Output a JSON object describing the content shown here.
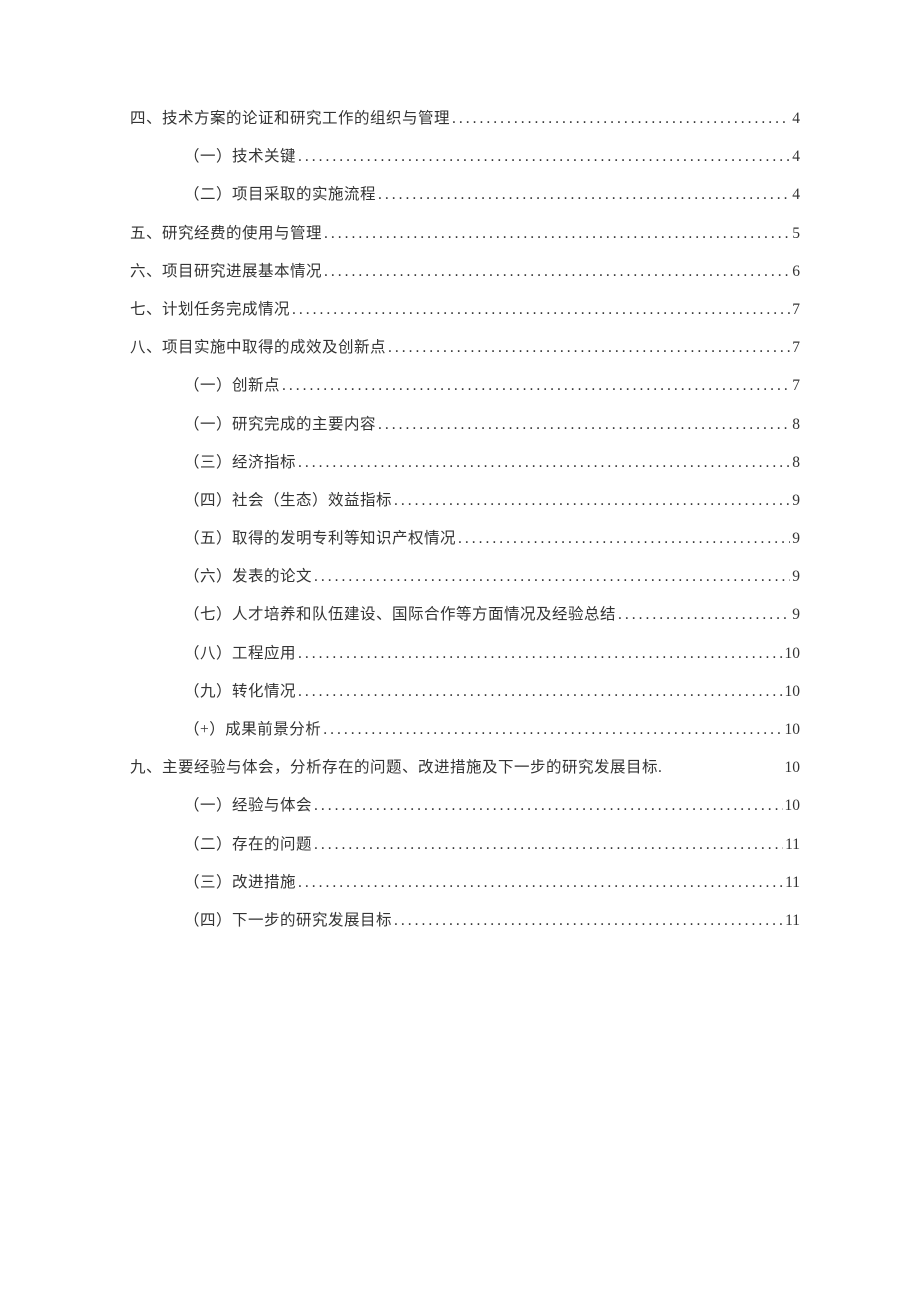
{
  "toc": [
    {
      "level": 1,
      "label": "四、技术方案的论证和研究工作的组织与管理",
      "page": "4",
      "dots": true
    },
    {
      "level": 2,
      "label": "（一）技术关键",
      "page": "4",
      "dots": true
    },
    {
      "level": 2,
      "label": "（二）项目采取的实施流程",
      "page": "4",
      "dots": true
    },
    {
      "level": 1,
      "label": "五、研究经费的使用与管理",
      "page": "5",
      "dots": true
    },
    {
      "level": 1,
      "label": "六、项目研究进展基本情况",
      "page": "6",
      "dots": true
    },
    {
      "level": 1,
      "label": "七、计划任务完成情况",
      "page": "7",
      "dots": true
    },
    {
      "level": 1,
      "label": "八、项目实施中取得的成效及创新点",
      "page": "7",
      "dots": true
    },
    {
      "level": 2,
      "label": "（一）创新点",
      "page": "7",
      "dots": true
    },
    {
      "level": 2,
      "label": "（一）研究完成的主要内容",
      "page": "8",
      "dots": true
    },
    {
      "level": 2,
      "label": "（三）经济指标",
      "page": "8",
      "dots": true
    },
    {
      "level": 2,
      "label": "（四）社会（生态）效益指标",
      "page": "9",
      "dots": true
    },
    {
      "level": 2,
      "label": "（五）取得的发明专利等知识产权情况",
      "page": "9",
      "dots": true
    },
    {
      "level": 2,
      "label": "（六）发表的论文",
      "page": "9",
      "dots": true
    },
    {
      "level": 2,
      "label": "（七）人才培养和队伍建设、国际合作等方面情况及经验总结",
      "page": "9",
      "dots": true
    },
    {
      "level": 2,
      "label": "（八）工程应用",
      "page": "10",
      "dots": true
    },
    {
      "level": 2,
      "label": "（九）转化情况",
      "page": "10",
      "dots": true
    },
    {
      "level": 2,
      "label": "（+）成果前景分析",
      "page": "10",
      "dots": true
    },
    {
      "level": 1,
      "label": "九、主要经验与体会，分析存在的问题、改进措施及下一步的研究发展目标.",
      "page": "10",
      "dots": false
    },
    {
      "level": 2,
      "label": "（一）经验与体会",
      "page": "10",
      "dots": true
    },
    {
      "level": 2,
      "label": "（二）存在的问题",
      "page": "11",
      "dots": true
    },
    {
      "level": 2,
      "label": "（三）改进措施",
      "page": "11",
      "dots": true
    },
    {
      "level": 2,
      "label": "（四）下一步的研究发展目标",
      "page": "11",
      "dots": true
    }
  ]
}
